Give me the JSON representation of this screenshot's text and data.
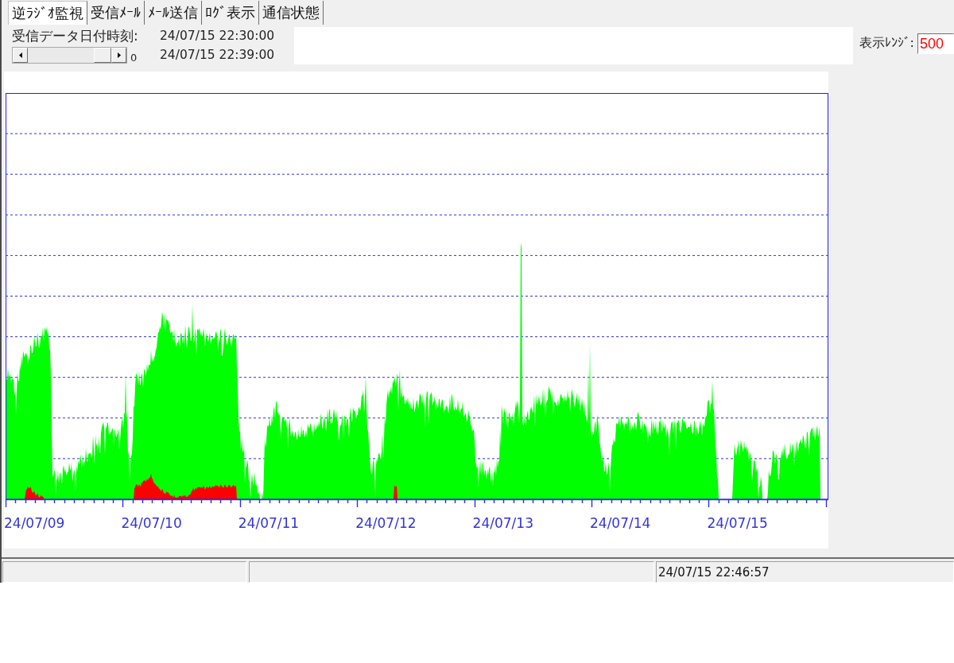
{
  "tabs": [
    {
      "label": "逆ﾗｼﾞｵ監視",
      "selected": true
    },
    {
      "label": "受信ﾒｰﾙ",
      "selected": false
    },
    {
      "label": "ﾒｰﾙ送信",
      "selected": false
    },
    {
      "label": "ﾛｸﾞ表示",
      "selected": false
    },
    {
      "label": "通信状態",
      "selected": false
    }
  ],
  "header": {
    "received_label": "受信データ日付時刻:",
    "received_from": "24/07/15 22:30:00",
    "scroll_value": "0",
    "received_to": "24/07/15 22:39:00"
  },
  "range": {
    "label": "表示ﾚﾝｼﾞ:",
    "value": "500"
  },
  "chart": {
    "x_labels": [
      "24/07/09",
      "24/07/10",
      "24/07/11",
      "24/07/12",
      "24/07/13",
      "24/07/14",
      "24/07/15"
    ]
  },
  "status_bar": {
    "time": "24/07/15 22:46:57"
  }
}
